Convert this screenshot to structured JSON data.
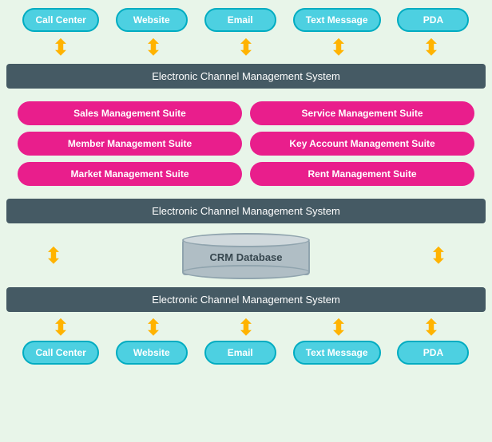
{
  "topChannels": [
    {
      "label": "Call Center"
    },
    {
      "label": "Website"
    },
    {
      "label": "Email"
    },
    {
      "label": "Text Message"
    },
    {
      "label": "PDA"
    }
  ],
  "bottomChannels": [
    {
      "label": "Call Center"
    },
    {
      "label": "Website"
    },
    {
      "label": "Email"
    },
    {
      "label": "Text Message"
    },
    {
      "label": "PDA"
    }
  ],
  "band1": "Electronic Channel Management System",
  "band2": "Electronic Channel Management System",
  "band3": "Electronic Channel Management System",
  "suites": [
    [
      "Sales Management Suite",
      "Service Management Suite"
    ],
    [
      "Member Management Suite",
      "Key Account Management Suite"
    ],
    [
      "Market Management Suite",
      "Rent Management Suite"
    ]
  ],
  "crm": "CRM Database",
  "arrowChar": "⬆⬇"
}
